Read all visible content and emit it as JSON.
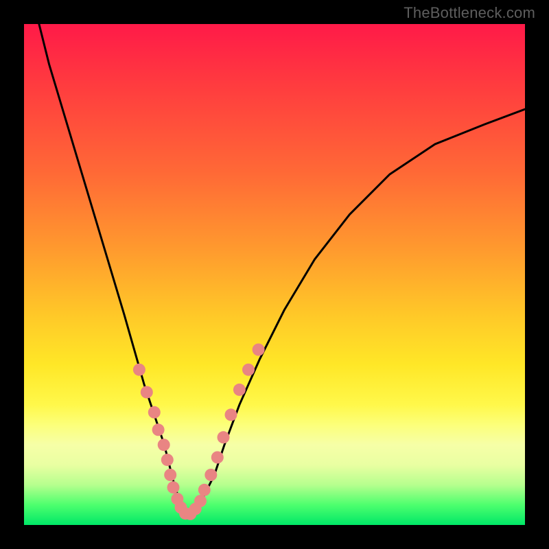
{
  "watermark": "TheBottleneck.com",
  "chart_data": {
    "type": "line",
    "title": "",
    "xlabel": "",
    "ylabel": "",
    "xlim": [
      0,
      100
    ],
    "ylim": [
      0,
      100
    ],
    "grid": false,
    "legend": false,
    "curve": {
      "name": "bottleneck-percentage",
      "color": "#000000",
      "x": [
        3,
        5,
        8,
        11,
        14,
        17,
        20,
        22,
        24,
        26,
        28,
        29,
        30,
        31,
        32,
        33,
        34,
        36,
        38,
        40,
        43,
        47,
        52,
        58,
        65,
        73,
        82,
        92,
        100
      ],
      "y": [
        100,
        92,
        82,
        72,
        62,
        52,
        42,
        35,
        28,
        22,
        16,
        12,
        8,
        5,
        3,
        2,
        3,
        6,
        10,
        16,
        24,
        33,
        43,
        53,
        62,
        70,
        76,
        80,
        83
      ]
    },
    "markers": {
      "name": "highlighted-points",
      "color": "#e98583",
      "radius_px": 9,
      "left_cluster": {
        "x": [
          23.0,
          24.5,
          26.0,
          26.8,
          27.9,
          28.6,
          29.2,
          29.8,
          30.6,
          31.3,
          32.2,
          33.2,
          34.2
        ],
        "y": [
          31.0,
          26.5,
          22.5,
          19.0,
          16.0,
          13.0,
          10.0,
          7.5,
          5.2,
          3.5,
          2.3,
          2.2,
          3.2
        ]
      },
      "right_cluster": {
        "x": [
          35.2,
          36.0,
          37.3,
          38.6,
          39.8,
          41.3,
          43.0,
          44.8,
          46.8
        ],
        "y": [
          4.8,
          7.0,
          10.0,
          13.5,
          17.5,
          22.0,
          27.0,
          31.0,
          35.0
        ]
      }
    },
    "minimum": {
      "x": 33,
      "y": 2
    }
  }
}
